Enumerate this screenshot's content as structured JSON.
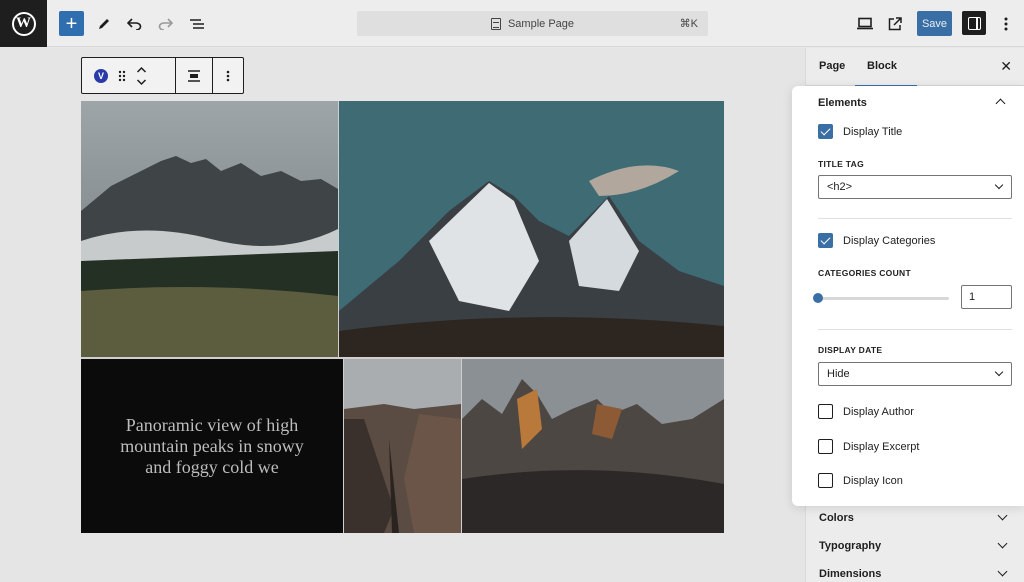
{
  "topbar": {
    "document_title": "Sample Page",
    "shortcut": "⌘K",
    "save_label": "Save"
  },
  "block_toolbar": {
    "block_badge": "V"
  },
  "canvas": {
    "caption_text": "Panoramic view of high mountain peaks in snowy and foggy cold we"
  },
  "sidebar": {
    "tabs": [
      {
        "label": "Page"
      },
      {
        "label": "Block"
      }
    ],
    "elements_panel": {
      "title": "Elements",
      "display_title": {
        "label": "Display Title",
        "checked": true
      },
      "title_tag": {
        "label": "TITLE TAG",
        "value": "<h2>"
      },
      "display_categories": {
        "label": "Display Categories",
        "checked": true
      },
      "categories_count": {
        "label": "CATEGORIES COUNT",
        "value": "1"
      },
      "display_date": {
        "label": "DISPLAY DATE",
        "value": "Hide"
      },
      "display_author": {
        "label": "Display Author",
        "checked": false
      },
      "display_excerpt": {
        "label": "Display Excerpt",
        "checked": false
      },
      "display_icon": {
        "label": "Display Icon",
        "checked": false
      }
    },
    "collapsed_panels": [
      {
        "label": "Colors"
      },
      {
        "label": "Typography"
      },
      {
        "label": "Dimensions"
      }
    ]
  },
  "colors": {
    "accent": "#3a6fa6",
    "dark": "#1e1e1e"
  }
}
